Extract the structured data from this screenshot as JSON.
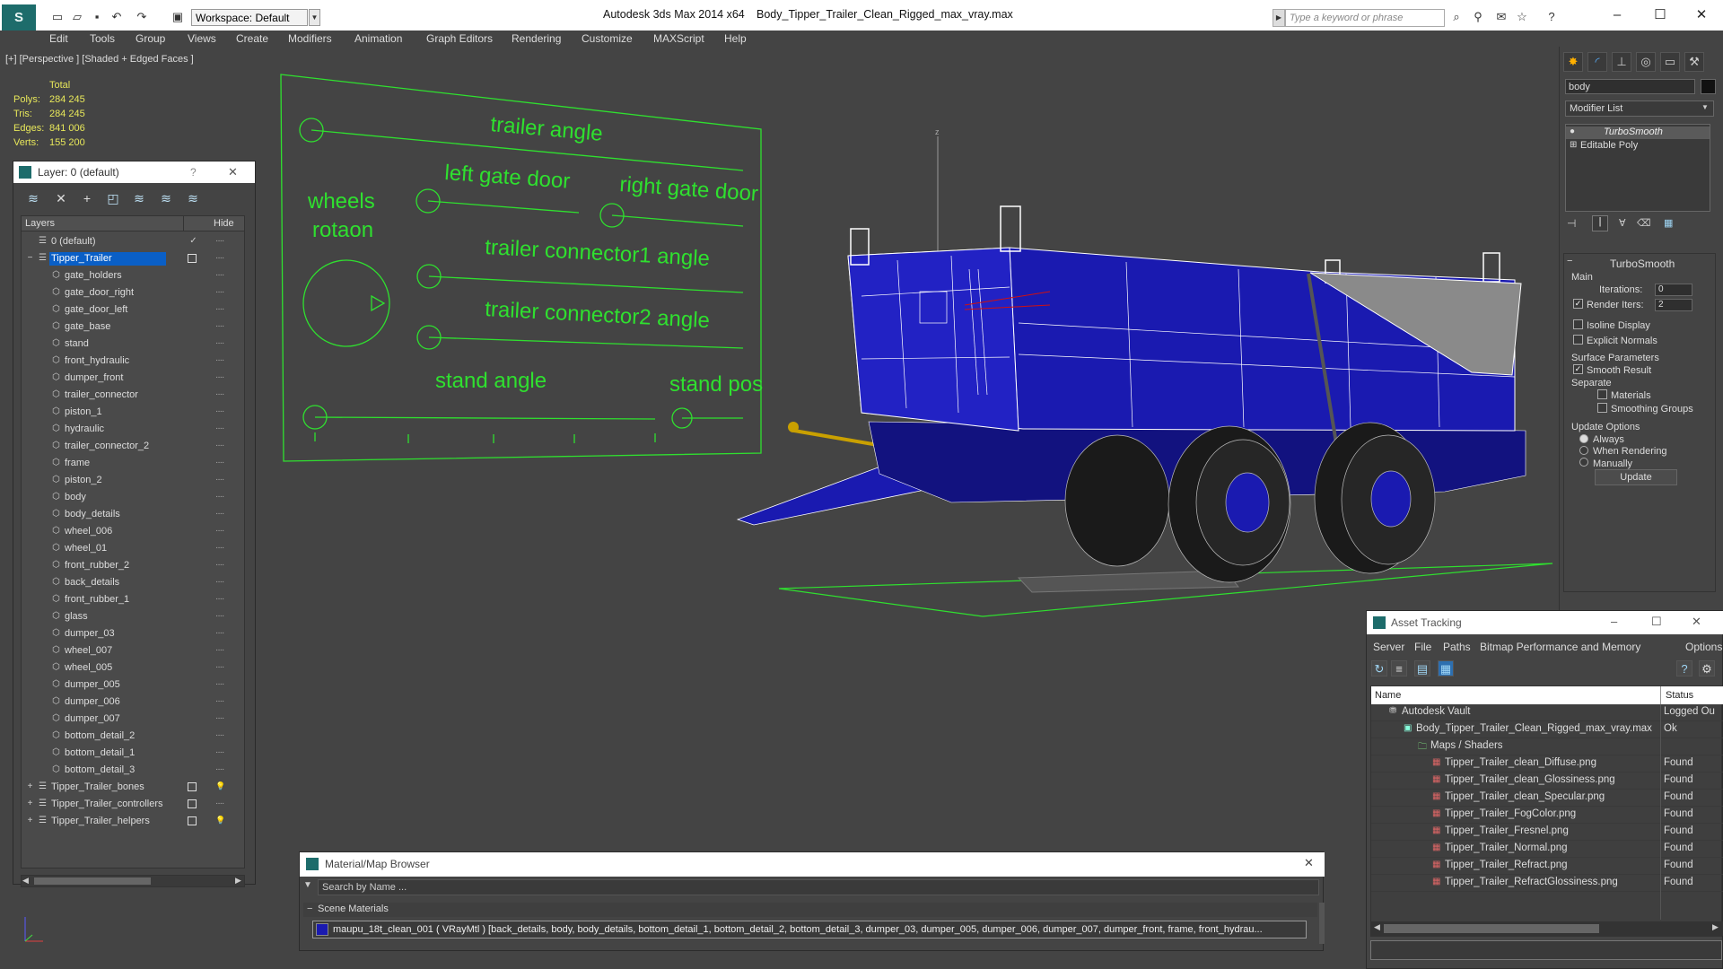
{
  "titlebar": {
    "app_logo": "S",
    "workspace": "Workspace: Default",
    "app_title": "Autodesk 3ds Max  2014 x64",
    "file_title": "Body_Tipper_Trailer_Clean_Rigged_max_vray.max",
    "search_placeholder": "Type a keyword or phrase",
    "min": "–",
    "max": "☐",
    "close": "✕"
  },
  "menu": [
    "Edit",
    "Tools",
    "Group",
    "Views",
    "Create",
    "Modifiers",
    "Animation",
    "Graph Editors",
    "Rendering",
    "Customize",
    "MAXScript",
    "Help"
  ],
  "viewport": {
    "label": "[+] [Perspective ] [Shaded + Edged Faces ]",
    "stats_header": "Total",
    "stats": [
      {
        "label": "Polys:",
        "value": "284 245"
      },
      {
        "label": "Tris:",
        "value": "284 245"
      },
      {
        "label": "Edges:",
        "value": "841 006"
      },
      {
        "label": "Verts:",
        "value": "155 200"
      }
    ],
    "axis_z": "z",
    "rig_labels": {
      "trailer_angle": "trailer angle",
      "left_gate_door": "left gate door",
      "right_gate_door": "right gate door",
      "wheels": "wheels",
      "rotaon": "rotaon",
      "connector1": "trailer connector1 angle",
      "connector2": "trailer connector2 angle",
      "stand_angle": "stand angle",
      "stand_pos": "stand pos"
    },
    "colors": {
      "rig": "#2fe02f",
      "trailer_blue": "#1a1ab0",
      "wire": "#ffffff",
      "grid": "#2fe02f"
    }
  },
  "layer_panel": {
    "title": "Layer: 0 (default)",
    "help": "?",
    "close": "✕",
    "col_layers": "Layers",
    "col_hide": "Hide",
    "rows": [
      {
        "name": "0 (default)",
        "level": 0,
        "check": true,
        "box": false,
        "bulb": false
      },
      {
        "name": "Tipper_Trailer",
        "level": 0,
        "selected": true,
        "box": true,
        "expand": "−"
      },
      {
        "name": "gate_holders",
        "level": 1
      },
      {
        "name": "gate_door_right",
        "level": 1
      },
      {
        "name": "gate_door_left",
        "level": 1
      },
      {
        "name": "gate_base",
        "level": 1
      },
      {
        "name": "stand",
        "level": 1
      },
      {
        "name": "front_hydraulic",
        "level": 1
      },
      {
        "name": "dumper_front",
        "level": 1
      },
      {
        "name": "trailer_connector",
        "level": 1
      },
      {
        "name": "piston_1",
        "level": 1
      },
      {
        "name": "hydraulic",
        "level": 1
      },
      {
        "name": "trailer_connector_2",
        "level": 1
      },
      {
        "name": "frame",
        "level": 1
      },
      {
        "name": "piston_2",
        "level": 1
      },
      {
        "name": "body",
        "level": 1
      },
      {
        "name": "body_details",
        "level": 1
      },
      {
        "name": "wheel_006",
        "level": 1
      },
      {
        "name": "wheel_01",
        "level": 1
      },
      {
        "name": "front_rubber_2",
        "level": 1
      },
      {
        "name": "back_details",
        "level": 1
      },
      {
        "name": "front_rubber_1",
        "level": 1
      },
      {
        "name": "glass",
        "level": 1
      },
      {
        "name": "dumper_03",
        "level": 1
      },
      {
        "name": "wheel_007",
        "level": 1
      },
      {
        "name": "wheel_005",
        "level": 1
      },
      {
        "name": "dumper_005",
        "level": 1
      },
      {
        "name": "dumper_006",
        "level": 1
      },
      {
        "name": "dumper_007",
        "level": 1
      },
      {
        "name": "bottom_detail_2",
        "level": 1
      },
      {
        "name": "bottom_detail_1",
        "level": 1
      },
      {
        "name": "bottom_detail_3",
        "level": 1
      },
      {
        "name": "Tipper_Trailer_bones",
        "level": 0,
        "box": true,
        "bulb": true,
        "expand": "+"
      },
      {
        "name": "Tipper_Trailer_controllers",
        "level": 0,
        "box": true,
        "expand": "+"
      },
      {
        "name": "Tipper_Trailer_helpers",
        "level": 0,
        "box": true,
        "bulb": true,
        "expand": "+"
      }
    ]
  },
  "command_panel": {
    "object_name": "body",
    "modifier_list": "Modifier List",
    "stack": [
      "TurboSmooth",
      "Editable Poly"
    ],
    "rollout_title": "TurboSmooth",
    "main": "Main",
    "iterations_label": "Iterations:",
    "iterations_value": "0",
    "render_iters_label": "Render Iters:",
    "render_iters_value": "2",
    "isoline": "Isoline Display",
    "explicit": "Explicit Normals",
    "surface_params": "Surface Parameters",
    "smooth_result": "Smooth Result",
    "separate": "Separate",
    "materials": "Materials",
    "smoothing_groups": "Smoothing Groups",
    "update_options": "Update Options",
    "always": "Always",
    "when_rendering": "When Rendering",
    "manually": "Manually",
    "update_btn": "Update"
  },
  "asset_tracking": {
    "title": "Asset Tracking",
    "menu": [
      "Server",
      "File",
      "Paths",
      "Bitmap Performance and Memory",
      "Options"
    ],
    "col_name": "Name",
    "col_status": "Status",
    "rows": [
      {
        "name": "Autodesk Vault",
        "status": "Logged Ou",
        "indent": 20,
        "icon": "vault"
      },
      {
        "name": "Body_Tipper_Trailer_Clean_Rigged_max_vray.max",
        "status": "Ok",
        "indent": 36,
        "icon": "max"
      },
      {
        "name": "Maps / Shaders",
        "status": "",
        "indent": 52,
        "icon": "maps"
      },
      {
        "name": "Tipper_Trailer_clean_Diffuse.png",
        "status": "Found",
        "indent": 68,
        "icon": "png"
      },
      {
        "name": "Tipper_Trailer_clean_Glossiness.png",
        "status": "Found",
        "indent": 68,
        "icon": "png"
      },
      {
        "name": "Tipper_Trailer_clean_Specular.png",
        "status": "Found",
        "indent": 68,
        "icon": "png"
      },
      {
        "name": "Tipper_Trailer_FogColor.png",
        "status": "Found",
        "indent": 68,
        "icon": "png"
      },
      {
        "name": "Tipper_Trailer_Fresnel.png",
        "status": "Found",
        "indent": 68,
        "icon": "png"
      },
      {
        "name": "Tipper_Trailer_Normal.png",
        "status": "Found",
        "indent": 68,
        "icon": "png"
      },
      {
        "name": "Tipper_Trailer_Refract.png",
        "status": "Found",
        "indent": 68,
        "icon": "png"
      },
      {
        "name": "Tipper_Trailer_RefractGlossiness.png",
        "status": "Found",
        "indent": 68,
        "icon": "png"
      }
    ]
  },
  "material_browser": {
    "title": "Material/Map Browser",
    "search_placeholder": "Search by Name ...",
    "section": "Scene Materials",
    "material": "maupu_18t_clean_001  ( VRayMtl ) [back_details, body, body_details, bottom_detail_1, bottom_detail_2, bottom_detail_3, dumper_03, dumper_005, dumper_006, dumper_007, dumper_front, frame, front_hydrau..."
  }
}
